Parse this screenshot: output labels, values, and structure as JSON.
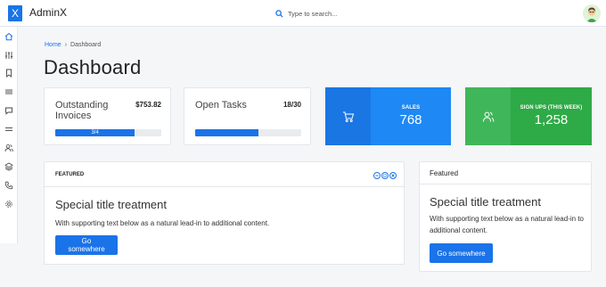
{
  "app": {
    "logo_letter": "X",
    "brand": "AdminX"
  },
  "search": {
    "placeholder": "Type to search..."
  },
  "sidebar": {
    "icons": [
      "home-icon",
      "sliders-icon",
      "bookmark-icon",
      "menu-icon",
      "chat-icon",
      "list-icon",
      "users-icon",
      "layers-icon",
      "phone-icon",
      "settings-icon"
    ]
  },
  "breadcrumb": {
    "home": "Home",
    "separator": "›",
    "current": "Dashboard"
  },
  "page": {
    "title": "Dashboard"
  },
  "stats": {
    "invoices": {
      "label": "Outstanding Invoices",
      "value": "$753.82",
      "progress_label": "3/4",
      "progress": 0.75
    },
    "tasks": {
      "label": "Open Tasks",
      "value": "18/30",
      "progress": 0.6
    }
  },
  "tiles": {
    "sales": {
      "title": "SALES",
      "value": "768",
      "color": "#1e88f5",
      "icon_bg": "#1976e3"
    },
    "signups": {
      "title": "SIGN UPS (THIS WEEK)",
      "value": "1,258",
      "color": "#2eaa47",
      "icon_bg": "#40b65a"
    }
  },
  "featured_main": {
    "header": "FEATURED",
    "title": "Special title treatment",
    "text": "With supporting text below as a natural lead-in to additional content.",
    "button": "Go somewhere"
  },
  "featured_side": {
    "header": "Featured",
    "title": "Special title treatment",
    "text": "With supporting text below as a natural lead-in to additional content.",
    "button": "Go somewhere"
  },
  "colors": {
    "primary": "#1a73e8",
    "background": "#f5f6f8"
  }
}
